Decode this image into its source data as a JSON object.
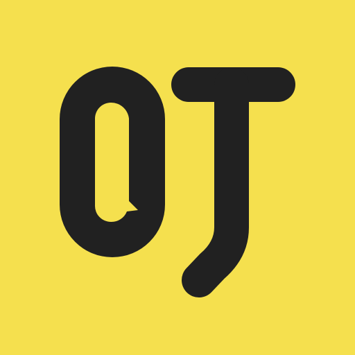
{
  "logo": {
    "text": "OT",
    "background_color": "#F5E04E",
    "foreground_color": "#212121"
  }
}
